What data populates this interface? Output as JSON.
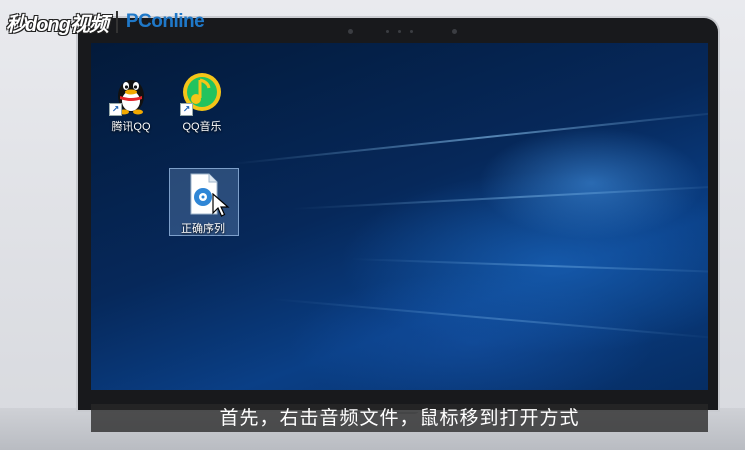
{
  "watermark": {
    "left_text": "秒dong视频",
    "right_text": "PConline"
  },
  "desktop": {
    "icons": [
      {
        "label": "腾讯QQ",
        "icon": "qq-penguin-icon",
        "shortcut": true
      },
      {
        "label": "QQ音乐",
        "icon": "qq-music-icon",
        "shortcut": true
      },
      {
        "label": "正确序列",
        "icon": "audio-file-icon",
        "shortcut": false,
        "selected": true
      }
    ]
  },
  "subtitle": "首先，右击音频文件，鼠标移到打开方式",
  "colors": {
    "desktop_bg": "#06285a",
    "watermark_blue": "#1f78c8",
    "qq_music_green": "#22c35e",
    "qq_music_yellow": "#f5c518"
  }
}
